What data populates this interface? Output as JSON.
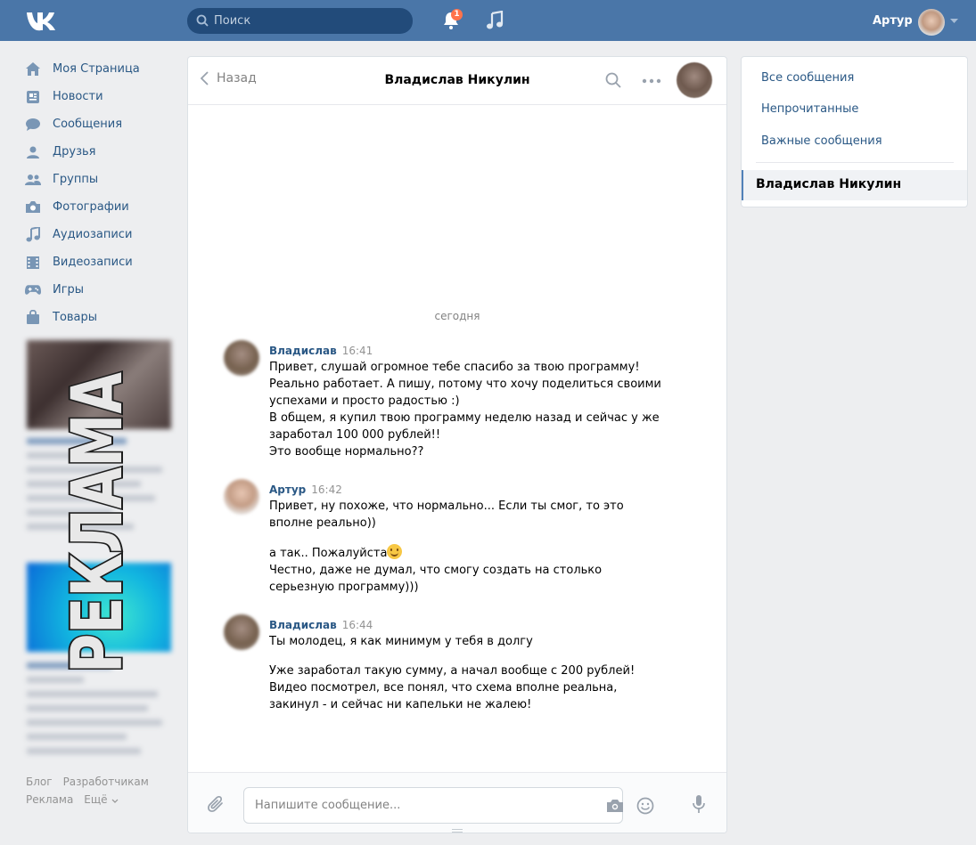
{
  "header": {
    "logo": "vk-logo",
    "search_placeholder": "Поиск",
    "notifications_count": "1",
    "user_name": "Артур",
    "brand_color": "#4a76a8"
  },
  "nav": [
    {
      "label": "Моя Страница",
      "icon": "home-icon"
    },
    {
      "label": "Новости",
      "icon": "news-icon"
    },
    {
      "label": "Сообщения",
      "icon": "messages-icon"
    },
    {
      "label": "Друзья",
      "icon": "friends-icon"
    },
    {
      "label": "Группы",
      "icon": "groups-icon"
    },
    {
      "label": "Фотографии",
      "icon": "photo-icon"
    },
    {
      "label": "Аудиозаписи",
      "icon": "audio-icon"
    },
    {
      "label": "Видеозаписи",
      "icon": "video-icon"
    },
    {
      "label": "Игры",
      "icon": "games-icon"
    },
    {
      "label": "Товары",
      "icon": "goods-icon"
    }
  ],
  "ad_stamp": "РЕКЛАМА",
  "footer": {
    "blog": "Блог",
    "developers": "Разработчикам",
    "ads": "Реклама",
    "more": "Ещё"
  },
  "chat": {
    "back_label": "Назад",
    "title": "Владислав Никулин",
    "day_separator": "сегодня",
    "messages": [
      {
        "author": "Владислав",
        "time": "16:41",
        "lines": [
          "Привет, слушай огромное тебе спасибо за твою программу!",
          "Реально работает. А пишу, потому что хочу поделиться своими",
          "успехами и просто радостью :)",
          "В общем, я купил твою программу неделю назад и сейчас у же",
          "заработал 100 000 рублей!!",
          "Это вообще нормально??"
        ]
      },
      {
        "author": "Артур",
        "time": "16:42",
        "lines": [
          "Привет, ну похоже, что нормально... Если ты смог, то это",
          "вполне реально))"
        ],
        "lines2": [
          "а так.. Пожалуйста",
          "Честно, даже не думал, что смогу создать на столько",
          "серьезную программу)))"
        ]
      },
      {
        "author": "Владислав",
        "time": "16:44",
        "lines": [
          "Ты молодец, я как минимум у тебя в долгу"
        ],
        "lines2": [
          "Уже заработал такую сумму, а начал вообще с 200 рублей!",
          "Видео посмотрел, все понял, что схема вполне реальна,",
          "закинул - и сейчас ни капельки не жалею!"
        ]
      }
    ],
    "composer_placeholder": "Напишите сообщение..."
  },
  "right_panel": {
    "all": "Все сообщения",
    "unread": "Непрочитанные",
    "important": "Важные сообщения",
    "active_dialog": "Владислав Никулин"
  }
}
